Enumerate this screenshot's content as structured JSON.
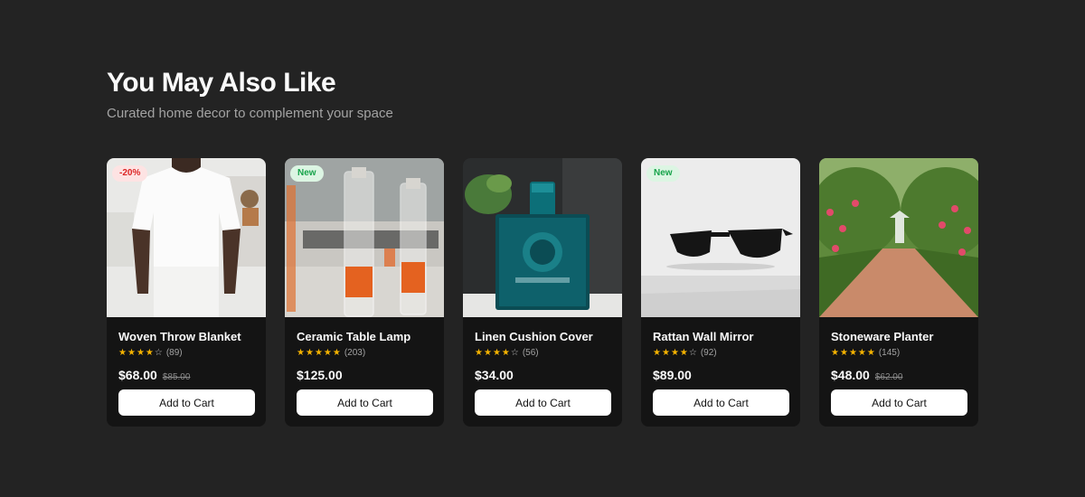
{
  "header": {
    "title": "You May Also Like",
    "subtitle": "Curated home decor to complement your space"
  },
  "colors": {
    "star": "#f5b301",
    "sale_badge_text": "#dc2626",
    "new_badge_text": "#16a34a"
  },
  "products": [
    {
      "name": "Woven Throw Blanket",
      "badge": "-20%",
      "badge_type": "sale",
      "rating": 4,
      "reviews": "(89)",
      "price": "$68.00",
      "old_price": "$85.00",
      "cta": "Add to Cart",
      "image": "white-tshirt"
    },
    {
      "name": "Ceramic Table Lamp",
      "badge": "New",
      "badge_type": "new",
      "rating": 5,
      "reviews": "(203)",
      "price": "$125.00",
      "old_price": "",
      "cta": "Add to Cart",
      "image": "glass-bottles"
    },
    {
      "name": "Linen Cushion Cover",
      "badge": "",
      "badge_type": "",
      "rating": 4,
      "reviews": "(56)",
      "price": "$34.00",
      "old_price": "",
      "cta": "Add to Cart",
      "image": "perfume-bottle"
    },
    {
      "name": "Rattan Wall Mirror",
      "badge": "New",
      "badge_type": "new",
      "rating": 4,
      "reviews": "(92)",
      "price": "$89.00",
      "old_price": "",
      "cta": "Add to Cart",
      "image": "sunglasses"
    },
    {
      "name": "Stoneware Planter",
      "badge": "",
      "badge_type": "",
      "rating": 5,
      "reviews": "(145)",
      "price": "$48.00",
      "old_price": "$62.00",
      "cta": "Add to Cart",
      "image": "garden-path"
    }
  ]
}
